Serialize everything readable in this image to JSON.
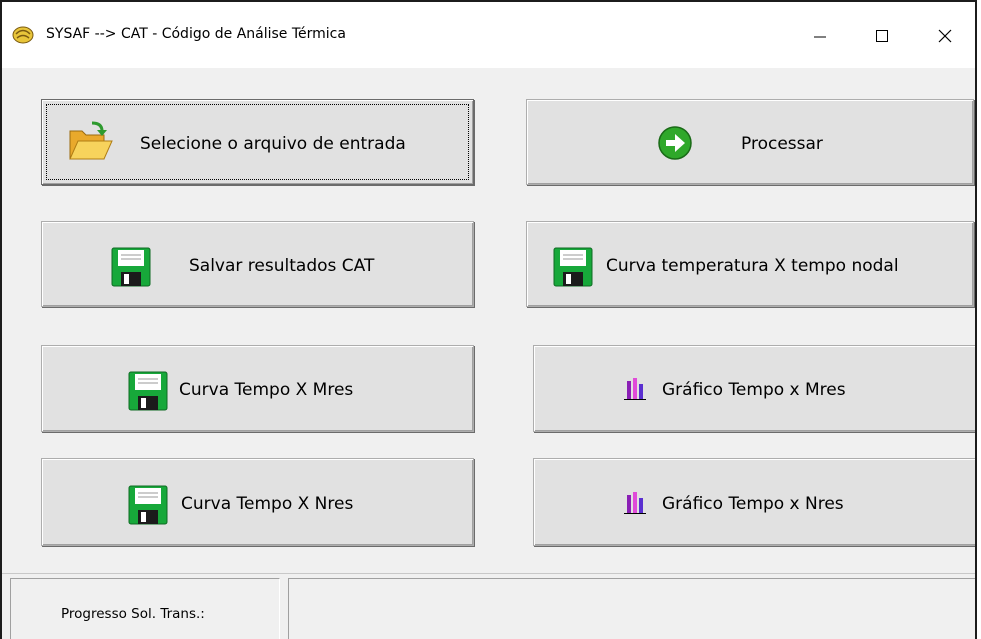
{
  "window": {
    "title": "SYSAF --> CAT - Código de Análise Térmica",
    "controls": {
      "minimize": "—",
      "maximize": "☐",
      "close": "✕"
    }
  },
  "buttons": {
    "select_input": "Selecione o arquivo de entrada",
    "process": "Processar",
    "save_results": "Salvar resultados CAT",
    "curve_temp_time": "Curva temperatura X tempo nodal",
    "curve_time_mres": "Curva Tempo X Mres",
    "graph_time_mres": "Gráfico Tempo x Mres",
    "curve_time_nres": "Curva Tempo X Nres",
    "graph_time_nres": "Gráfico Tempo x Nres"
  },
  "icons": {
    "select_input": "folder-open-icon",
    "process": "arrow-right-circle-icon",
    "save": "floppy-disk-icon",
    "chart": "bar-chart-icon"
  },
  "status": {
    "progress_label": "Progresso Sol. Trans.:",
    "progress": 0
  },
  "colors": {
    "titlebar_bg": "#ffffff",
    "client_bg": "#f0f0f0",
    "button_face": "#e1e1e1",
    "floppy_green": "#17a83a",
    "arrow_green": "#2fa82a",
    "folder_yellow": "#f4c441"
  }
}
